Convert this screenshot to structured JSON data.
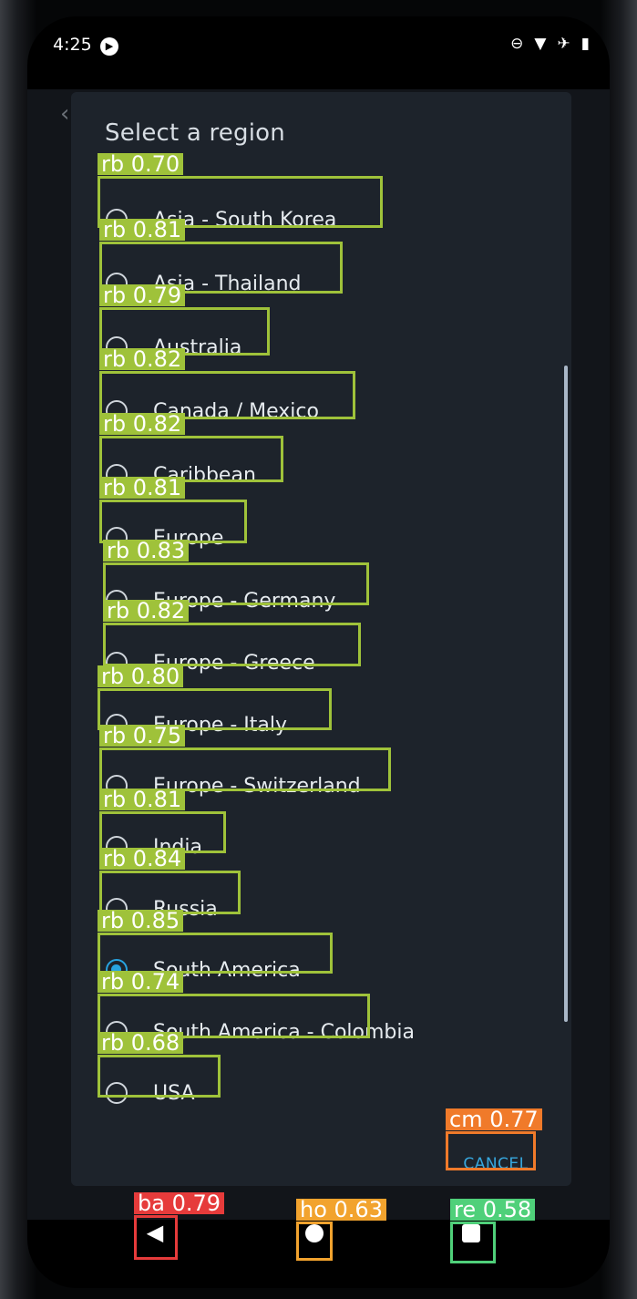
{
  "status": {
    "time": "4:25"
  },
  "dialog": {
    "title": "Select a region",
    "options": [
      {
        "label": "Asia - South Korea",
        "checked": false
      },
      {
        "label": "Asia - Thailand",
        "checked": false
      },
      {
        "label": "Australia",
        "checked": false
      },
      {
        "label": "Canada / Mexico",
        "checked": false
      },
      {
        "label": "Caribbean",
        "checked": false
      },
      {
        "label": "Europe",
        "checked": false
      },
      {
        "label": "Europe - Germany",
        "checked": false
      },
      {
        "label": "Europe - Greece",
        "checked": false
      },
      {
        "label": "Europe - Italy",
        "checked": false
      },
      {
        "label": "Europe - Switzerland",
        "checked": false
      },
      {
        "label": "India",
        "checked": false
      },
      {
        "label": "Russia",
        "checked": false
      },
      {
        "label": "South America",
        "checked": true
      },
      {
        "label": "South America - Colombia",
        "checked": false
      },
      {
        "label": "USA",
        "checked": false
      }
    ],
    "cancel_label": "CANCEL"
  },
  "detections": [
    {
      "tag": "rb 0.70"
    },
    {
      "tag": "rb 0.81"
    },
    {
      "tag": "rb 0.79"
    },
    {
      "tag": "rb 0.82"
    },
    {
      "tag": "rb 0.82"
    },
    {
      "tag": "rb 0.81"
    },
    {
      "tag": "rb 0.83"
    },
    {
      "tag": "rb 0.82"
    },
    {
      "tag": "rb 0.80"
    },
    {
      "tag": "rb 0.75"
    },
    {
      "tag": "rb 0.81"
    },
    {
      "tag": "rb 0.84"
    },
    {
      "tag": "rb 0.85"
    },
    {
      "tag": "rb 0.74"
    },
    {
      "tag": "rb 0.68"
    },
    {
      "tag": "cm 0.77"
    },
    {
      "tag": "ba 0.79"
    },
    {
      "tag": "ho 0.63"
    },
    {
      "tag": "re 0.58"
    }
  ],
  "colors": {
    "radio_box": "#9fc23a",
    "cancel_box": "#f07a2a",
    "back_box": "#e63b3b",
    "home_box": "#f2a32e",
    "recent_box": "#4fd07a"
  }
}
